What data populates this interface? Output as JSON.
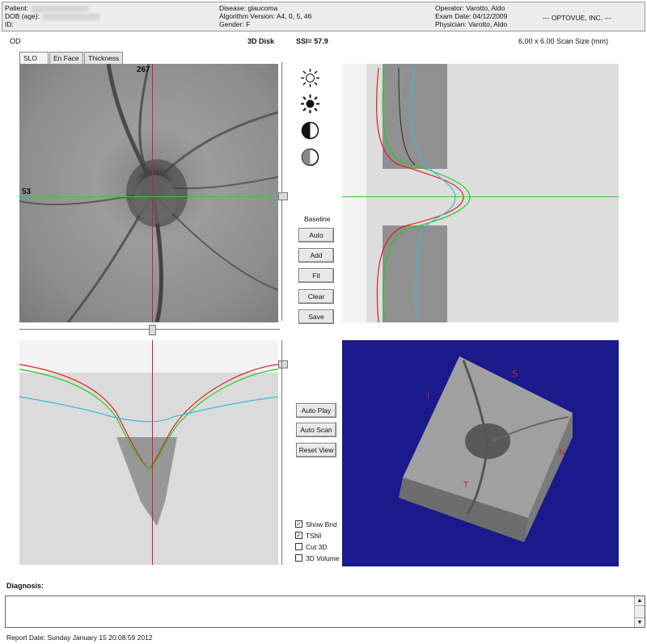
{
  "header": {
    "patient_label": "Patient:",
    "dob_label": "DOB (age):",
    "id_label": "ID:",
    "disease": "Disease: glaucoma",
    "algorithm": "Algorithm Version: A4, 0, 5, 46",
    "gender": "Gender: F",
    "operator": "Operator: Varotto, Aldo",
    "exam_date": "Exam Date: 04/12/2009",
    "physician": "Physician: Varotto, Aldo",
    "company": "--- OPTOVUE, INC. ---"
  },
  "scan": {
    "eye": "OD",
    "mode": "3D Disk",
    "ssi": "SSI= 57.9",
    "scan_size": "6.00 x 6.00 Scan Size (mm)"
  },
  "tabs": [
    "SLO",
    "En Face",
    "Thickness"
  ],
  "markers": {
    "vertical": "267",
    "horizontal": "53"
  },
  "icons": [
    "brightness-low-icon",
    "brightness-high-icon",
    "contrast-icon",
    "contrast-low-icon"
  ],
  "baseline": {
    "label": "Baseline",
    "buttons": [
      "Auto",
      "Add",
      "Fit",
      "Clear",
      "Save"
    ]
  },
  "view_buttons": [
    "Auto Play",
    "Auto Scan",
    "Reset View"
  ],
  "checkboxes": [
    {
      "label": "Show Bnd",
      "checked": true
    },
    {
      "label": "TSNI",
      "checked": true
    },
    {
      "label": "Cut 3D",
      "checked": false
    },
    {
      "label": "3D Volume",
      "checked": false
    }
  ],
  "diagnosis_label": "Diagnosis:",
  "report_date": "Report Date: Sunday January 15 20:08:59 2012",
  "colors": {
    "crosshair_v": "#d0202a",
    "crosshair_h": "#33cc33",
    "cube_bg": "#1a1a8c"
  }
}
